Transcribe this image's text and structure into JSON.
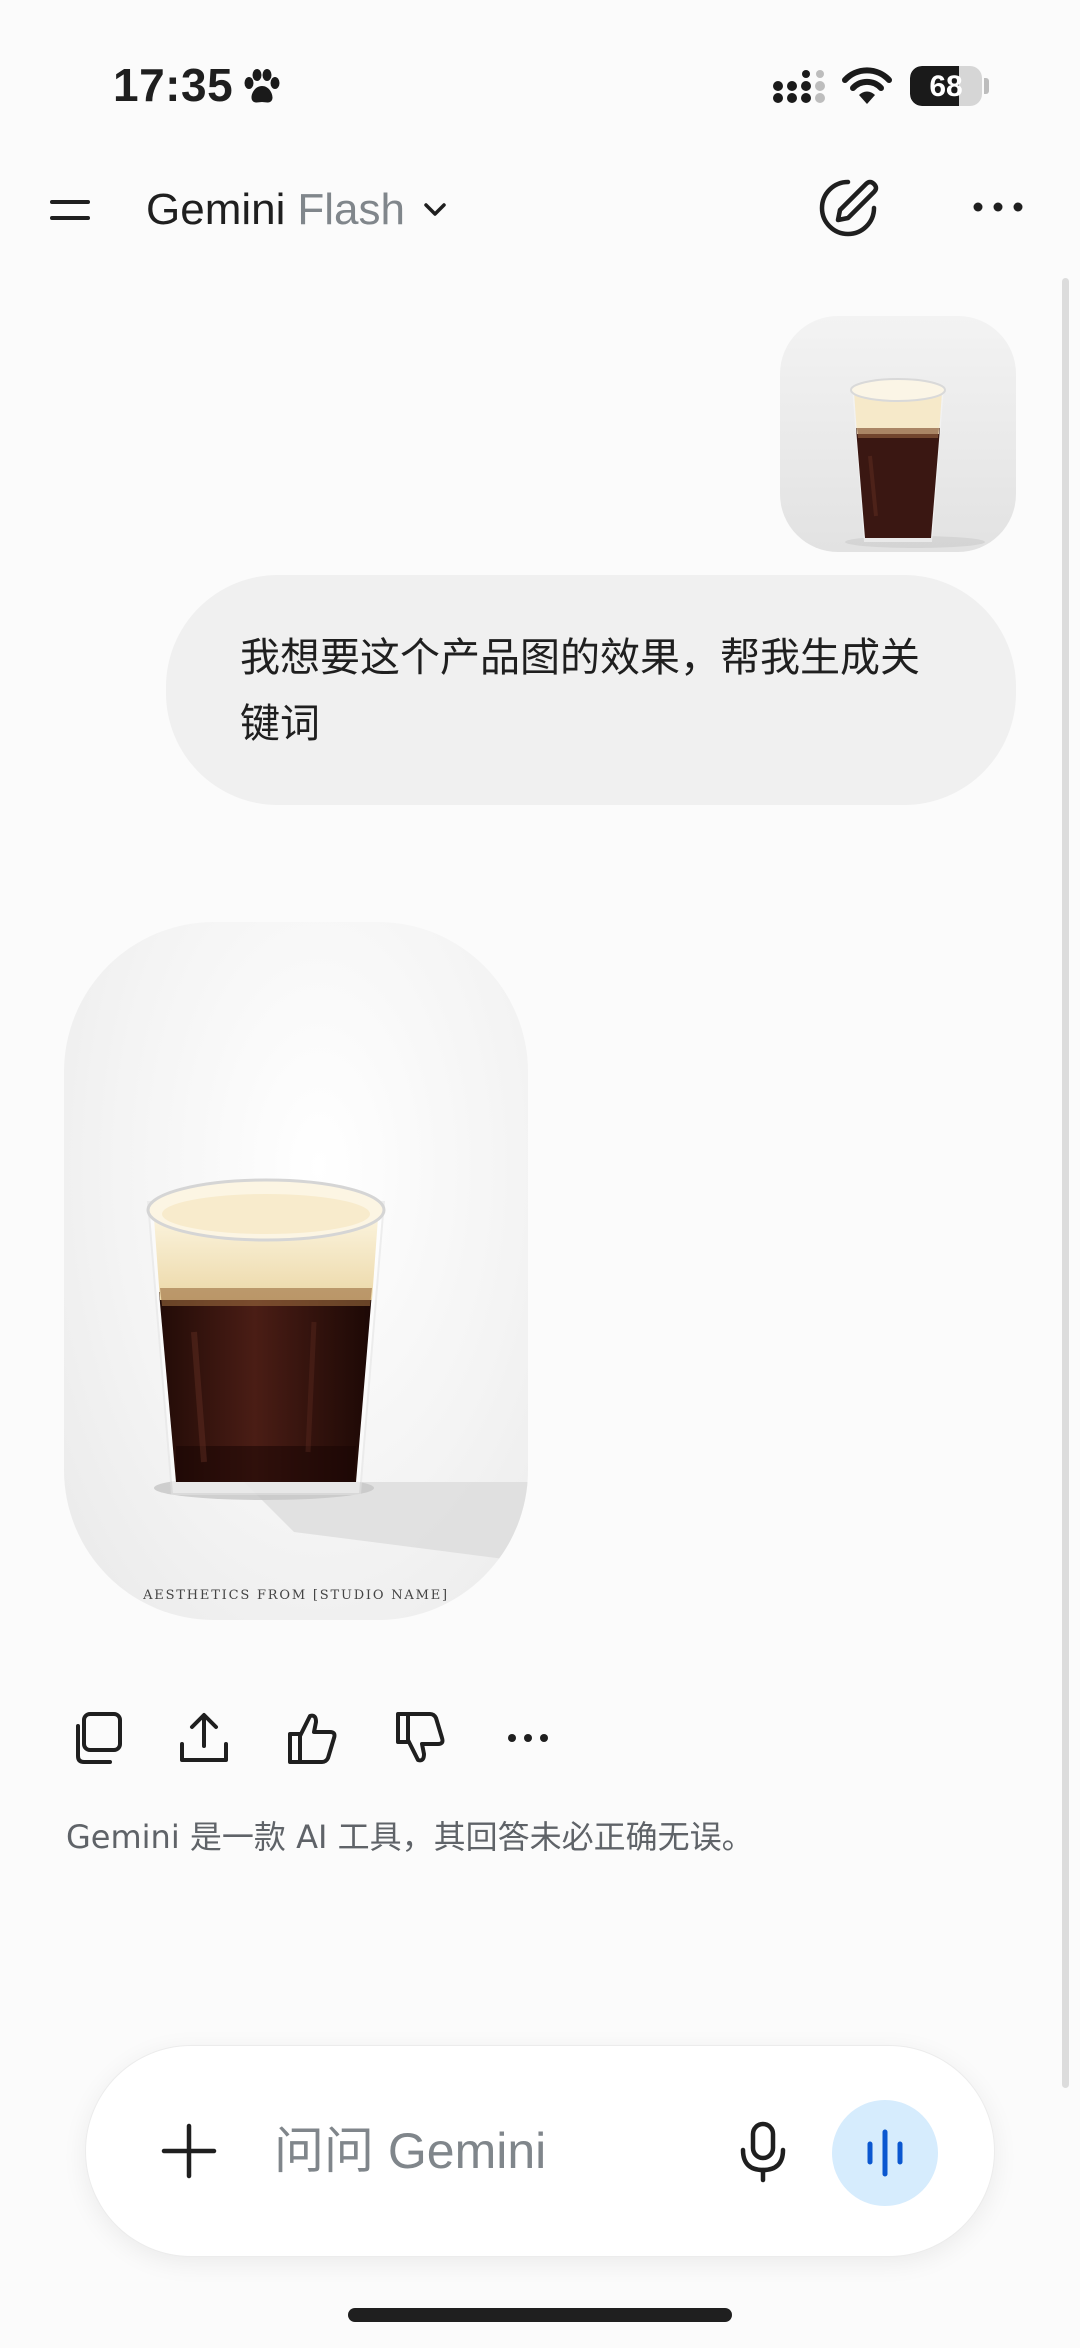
{
  "status_bar": {
    "time": "17:35",
    "battery_level": "68",
    "battery_fraction": 0.68
  },
  "header": {
    "model_name": "Gemini",
    "model_variant": "Flash",
    "icons": {
      "menu": "menu-icon",
      "dropdown": "chevron-down-icon",
      "new_chat": "edit-pen-icon",
      "more": "more-horizontal-icon"
    }
  },
  "conversation": {
    "user_message": "我想要这个产品图的效果，帮我生成关键词",
    "generated_image_caption": "AESTHETICS FROM [STUDIO NAME]",
    "actions": [
      "copy-icon",
      "share-icon",
      "thumbs-up-icon",
      "thumbs-down-icon",
      "more-horizontal-icon"
    ],
    "disclaimer": "Gemini 是一款 AI 工具，其回答未必正确无误。"
  },
  "input": {
    "placeholder": "问问 Gemini",
    "value": "",
    "icons": {
      "add": "plus-icon",
      "mic": "microphone-icon",
      "live": "voice-waveform-icon"
    },
    "live_color": "#d6ecfd"
  },
  "colors": {
    "background": "#fbfbfb",
    "user_bubble": "#f0f0f0",
    "muted_text": "#80868b",
    "coffee": "#3a1712",
    "foam": "#f6e9c9"
  }
}
